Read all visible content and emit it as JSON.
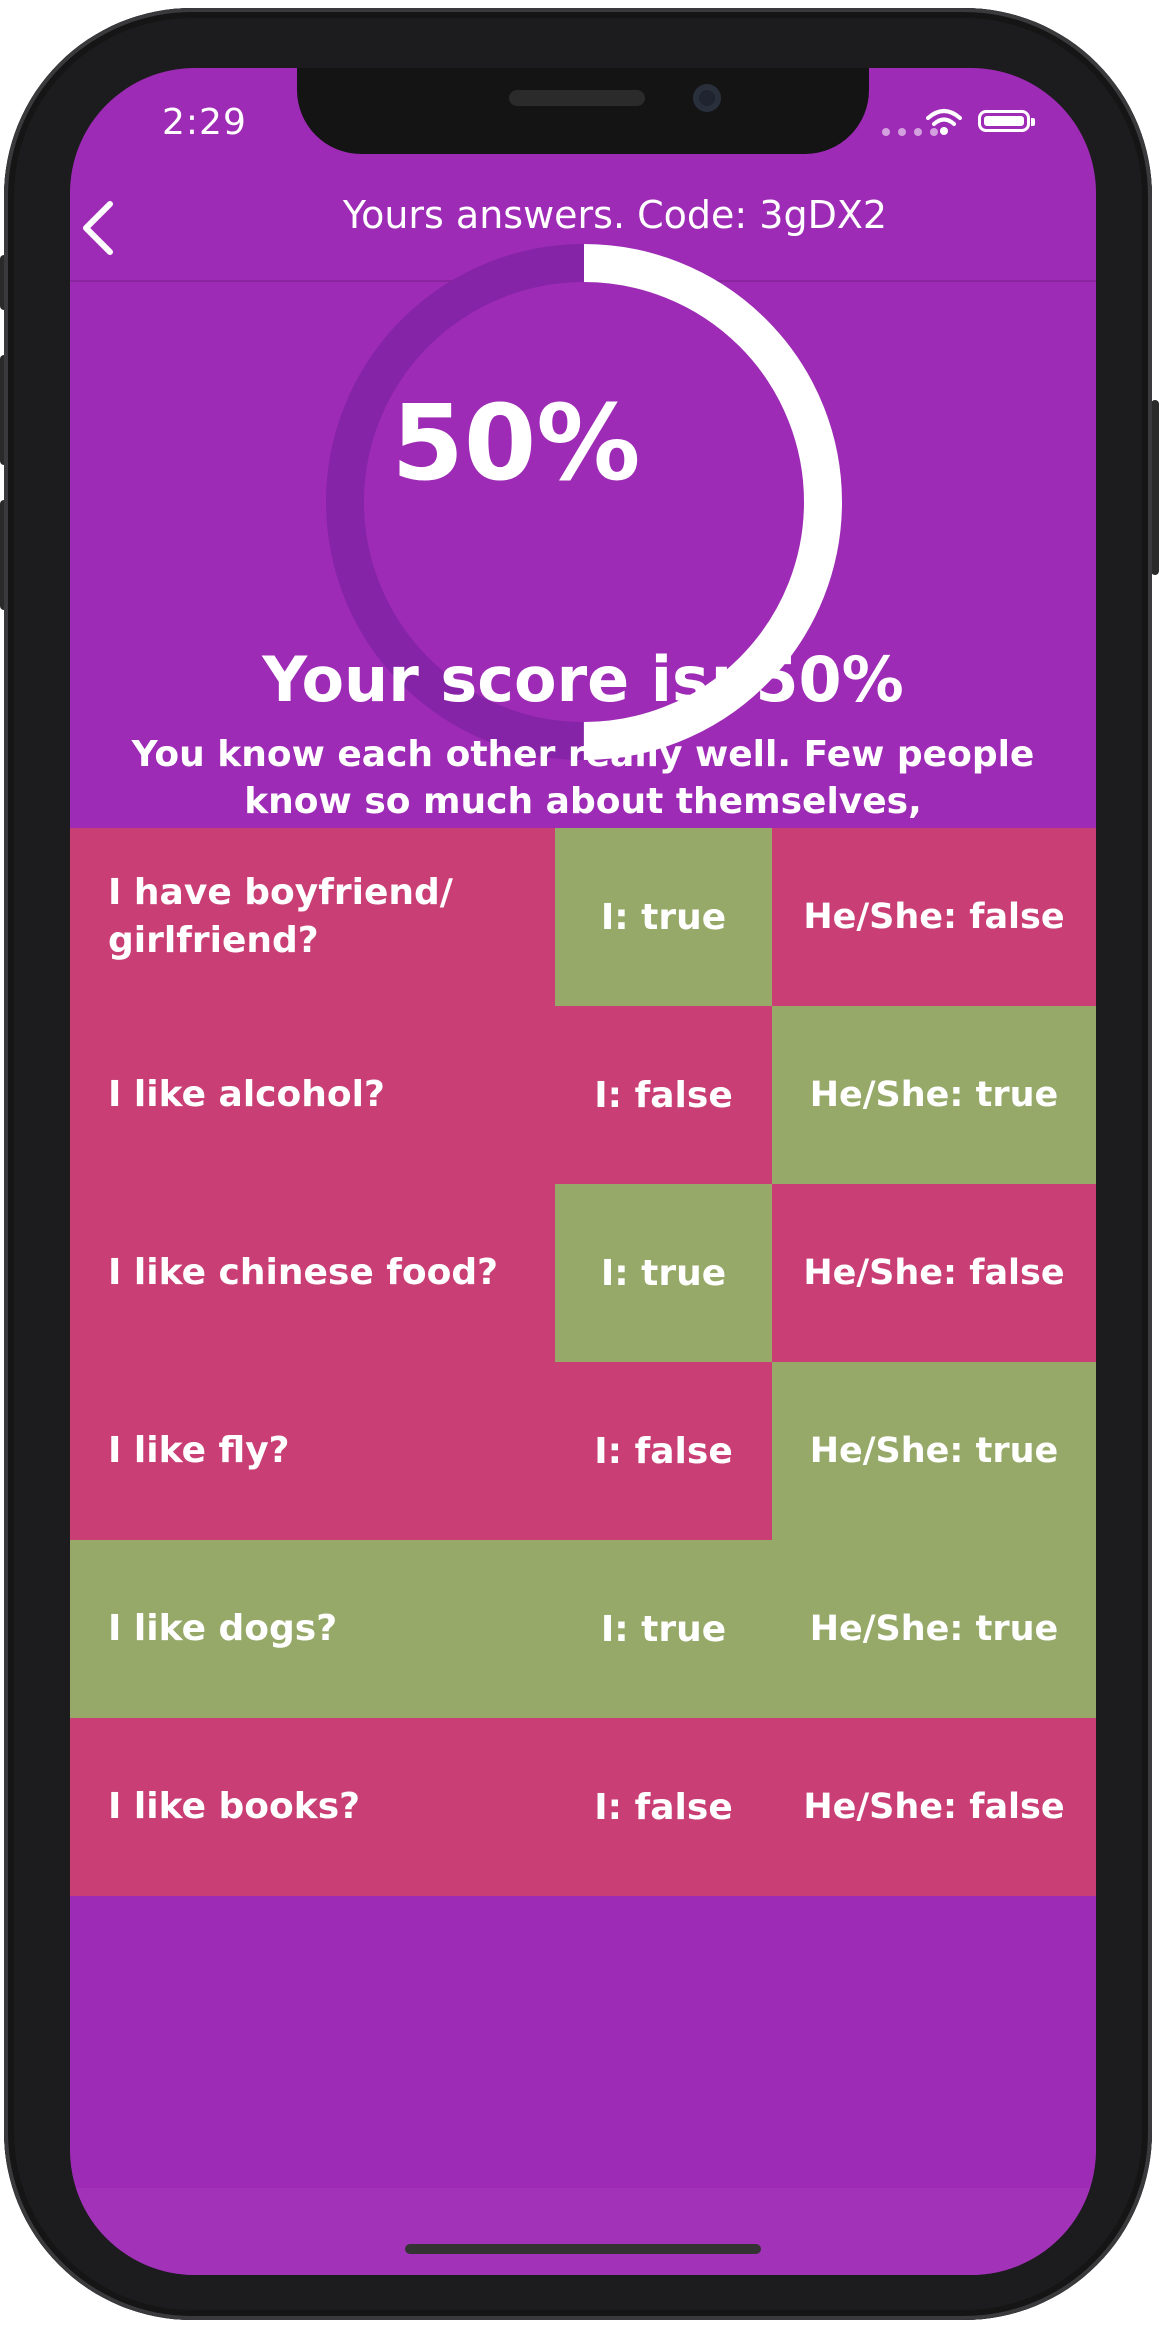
{
  "status": {
    "time": "2:29"
  },
  "nav": {
    "title": "Yours answers. Code: 3gDX2"
  },
  "score": {
    "percent_label": "50%",
    "fraction": 0.5,
    "title": "Your score is: 50%",
    "description": "You know each other really well. Few people know so much about themselves, congratulations."
  },
  "answers": [
    {
      "question": "I have boyfriend/ girlfriend?",
      "mine": "I:  true",
      "theirs": "He/She: false",
      "q_color": "red",
      "mine_color": "green",
      "theirs_color": "red"
    },
    {
      "question": "I like alcohol?",
      "mine": "I:  false",
      "theirs": "He/She: true",
      "q_color": "red",
      "mine_color": "red",
      "theirs_color": "green"
    },
    {
      "question": "I like chinese food?",
      "mine": "I:  true",
      "theirs": "He/She: false",
      "q_color": "red",
      "mine_color": "green",
      "theirs_color": "red"
    },
    {
      "question": "I like fly?",
      "mine": "I:  false",
      "theirs": "He/She: true",
      "q_color": "red",
      "mine_color": "red",
      "theirs_color": "green"
    },
    {
      "question": "I like dogs?",
      "mine": "I:  true",
      "theirs": "He/She: true",
      "q_color": "green",
      "mine_color": "green",
      "theirs_color": "green"
    },
    {
      "question": "I like books?",
      "mine": "I:  false",
      "theirs": "He/She: false",
      "q_color": "red",
      "mine_color": "red",
      "theirs_color": "red"
    }
  ],
  "colors": {
    "background": "#9e2bb5",
    "ring_track": "#8524a6",
    "ring_progress": "#ffffff",
    "wrong": "#c93e74",
    "correct": "#96a968"
  },
  "icons": [
    "chevron-left-icon",
    "wifi-icon",
    "battery-icon"
  ]
}
